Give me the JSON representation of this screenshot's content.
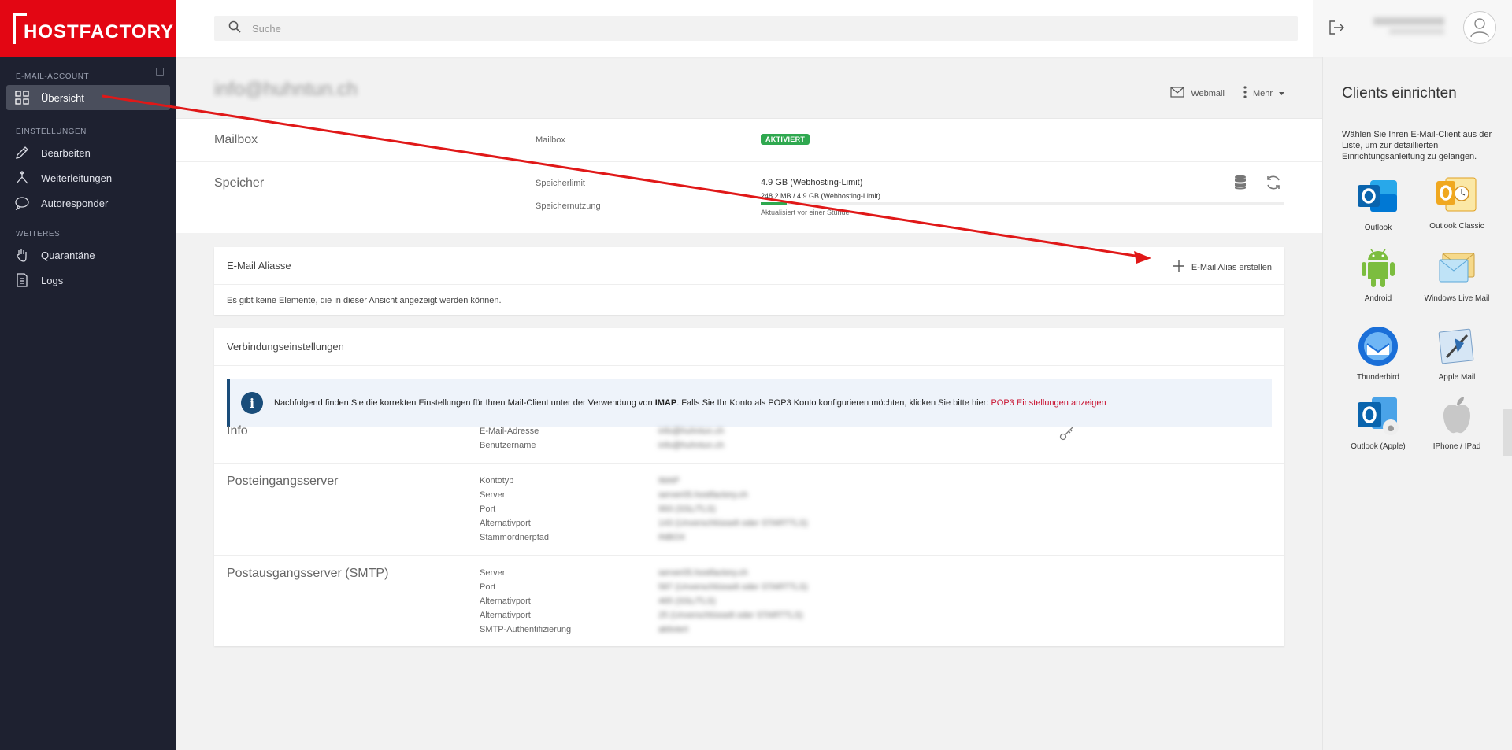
{
  "brand": {
    "name": "HOSTFACTORY",
    "color": "#e30613"
  },
  "search": {
    "placeholder": "Suche"
  },
  "sidebar": {
    "sections": [
      {
        "label": "E-MAIL-ACCOUNT"
      },
      {
        "label": "EINSTELLUNGEN"
      },
      {
        "label": "WEITERES"
      }
    ],
    "items": [
      {
        "label": "Übersicht",
        "icon": "grid-icon",
        "active": true
      },
      {
        "label": "Bearbeiten",
        "icon": "pencil-icon"
      },
      {
        "label": "Weiterleitungen",
        "icon": "fork-icon"
      },
      {
        "label": "Autoresponder",
        "icon": "chat-icon"
      },
      {
        "label": "Quarantäne",
        "icon": "hand-icon"
      },
      {
        "label": "Logs",
        "icon": "document-icon"
      }
    ]
  },
  "header": {
    "email": "info@huhntun.ch",
    "webmail_label": "Webmail",
    "more_label": "Mehr"
  },
  "mailbox": {
    "title": "Mailbox",
    "label": "Mailbox",
    "status": "AKTIVIERT",
    "status_color": "#2fa84f"
  },
  "storage": {
    "title": "Speicher",
    "limit_label": "Speicherlimit",
    "limit_value": "4.9 GB (Webhosting-Limit)",
    "usage_label": "Speichernutzung",
    "usage_value": "248.2 MB / 4.9 GB (Webhosting-Limit)",
    "usage_fraction": 0.05,
    "updated": "Aktualisiert vor einer Stunde"
  },
  "aliases": {
    "title": "E-Mail Aliasse",
    "create_label": "E-Mail Alias erstellen",
    "empty": "Es gibt keine Elemente, die in dieser Ansicht angezeigt werden können."
  },
  "connection": {
    "title": "Verbindungseinstellungen",
    "info_prefix": "Nachfolgend finden Sie die korrekten Einstellungen für Ihren Mail-Client unter der Verwendung von ",
    "info_bold": "IMAP",
    "info_suffix": ". Falls Sie Ihr Konto als POP3 Konto konfigurieren möchten, klicken Sie bitte hier: ",
    "info_link": "POP3 Einstellungen anzeigen",
    "info_section": {
      "title": "Info",
      "rows": [
        {
          "label": "E-Mail-Adresse",
          "value": "info@huhntun.ch"
        },
        {
          "label": "Benutzername",
          "value": "info@huhntun.ch"
        }
      ]
    },
    "incoming": {
      "title": "Posteingangsserver",
      "rows": [
        {
          "label": "Kontotyp",
          "value": "IMAP"
        },
        {
          "label": "Server",
          "value": "server05.hostfactory.ch"
        },
        {
          "label": "Port",
          "value": "993 (SSL/TLS)"
        },
        {
          "label": "Alternativport",
          "value": "143 (Unverschlüsselt oder STARTTLS)"
        },
        {
          "label": "Stammordnerpfad",
          "value": "INBOX"
        }
      ]
    },
    "outgoing": {
      "title": "Postausgangsserver (SMTP)",
      "rows": [
        {
          "label": "Server",
          "value": "server05.hostfactory.ch"
        },
        {
          "label": "Port",
          "value": "587 (Unverschlüsselt oder STARTTLS)"
        },
        {
          "label": "Alternativport",
          "value": "465 (SSL/TLS)"
        },
        {
          "label": "Alternativport",
          "value": "25 (Unverschlüsselt oder STARTTLS)"
        },
        {
          "label": "SMTP-Authentifizierung",
          "value": "aktiviert"
        }
      ]
    }
  },
  "clients": {
    "title": "Clients einrichten",
    "description": "Wählen Sie Ihren E-Mail-Client aus der Liste, um zur detaillierten Einrichtungsanleitung zu gelangen.",
    "items": [
      {
        "label": "Outlook",
        "icon": "outlook-icon"
      },
      {
        "label": "Outlook Classic",
        "icon": "outlook-classic-icon"
      },
      {
        "label": "Android",
        "icon": "android-icon"
      },
      {
        "label": "Windows Live Mail",
        "icon": "windows-live-mail-icon"
      },
      {
        "label": "Thunderbird",
        "icon": "thunderbird-icon"
      },
      {
        "label": "Apple Mail",
        "icon": "apple-mail-icon"
      },
      {
        "label": "Outlook (Apple)",
        "icon": "outlook-apple-icon"
      },
      {
        "label": "IPhone / IPad",
        "icon": "apple-icon"
      }
    ]
  }
}
